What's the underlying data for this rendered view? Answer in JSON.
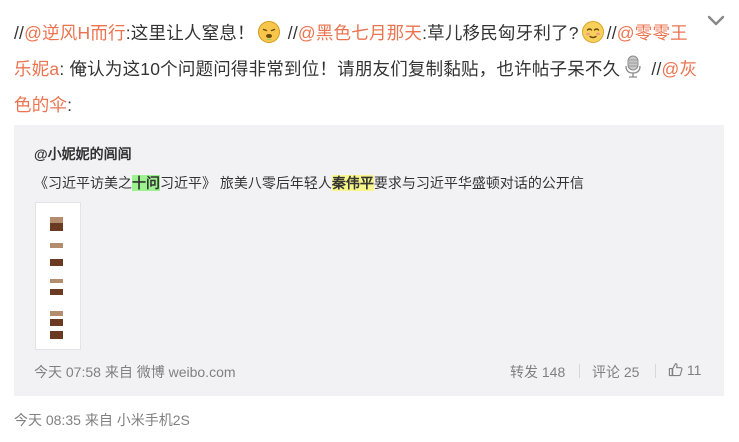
{
  "post": {
    "segments": [
      {
        "t": "//",
        "m": false
      },
      {
        "t": "@逆风H而行",
        "m": true
      },
      {
        "t": ":这里让人窒息！",
        "m": false
      },
      {
        "emoji": "sick"
      },
      {
        "t": " //",
        "m": false
      },
      {
        "t": "@黑色七月那天",
        "m": true
      },
      {
        "t": ":草儿移民匈牙利了?",
        "m": false
      },
      {
        "emoji": "shy"
      },
      {
        "t": "//",
        "m": false
      },
      {
        "t": "@零零王乐妮a",
        "m": true
      },
      {
        "t": ": 俺认为这10个问题问得非常到位！请朋友们复制黏贴，也许帖子呆不久",
        "m": false
      },
      {
        "emoji": "mic"
      },
      {
        "t": " //",
        "m": false
      },
      {
        "t": "@灰色的伞",
        "m": true
      },
      {
        "t": ":",
        "m": false
      }
    ],
    "time": "今天 08:35",
    "via": "来自",
    "source": "小米手机2S"
  },
  "quoted": {
    "author": "@小妮妮的闾闾",
    "text_parts": [
      {
        "t": "《习近平访美之",
        "h": ""
      },
      {
        "t": "十问",
        "h": "green"
      },
      {
        "t": "习近平》 旅美八零后年轻人",
        "h": ""
      },
      {
        "t": "秦伟平",
        "h": "yellow"
      },
      {
        "t": "要求与习近平华盛顿对话的公开信",
        "h": ""
      }
    ],
    "time": "今天 07:58",
    "via": "来自",
    "source": "微博 weibo.com",
    "repost_label": "转发 148",
    "comment_label": "评论 25",
    "like_count": "11"
  },
  "icons": {
    "menu": "chevron-down-icon",
    "like": "thumbs-up-icon",
    "thumbnail": "image-thumbnail"
  },
  "colors": {
    "mention": "#eb7350",
    "quote_bg": "#f2f2f5",
    "meta": "#808080",
    "highlight_green": "#9cf28e",
    "highlight_yellow": "#f8f68a"
  }
}
